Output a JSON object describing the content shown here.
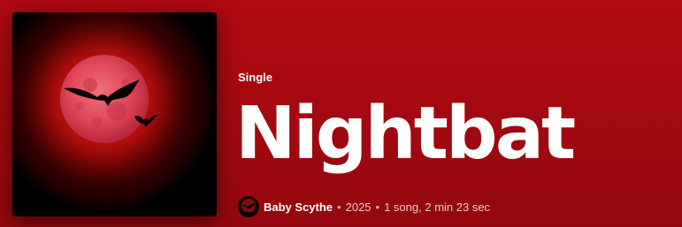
{
  "album": {
    "type_label": "Single",
    "title": "Nightbat",
    "artist": "Baby Scythe",
    "year": "2025",
    "summary": "1 song, 2 min 23 sec",
    "separator": "•"
  },
  "cover": {
    "icon": "blood-moon-bats-cover-art"
  },
  "colors": {
    "background_top": "#b00a12",
    "background_bottom": "#93080e",
    "moon": "#e0485c",
    "text": "#ffffff"
  }
}
